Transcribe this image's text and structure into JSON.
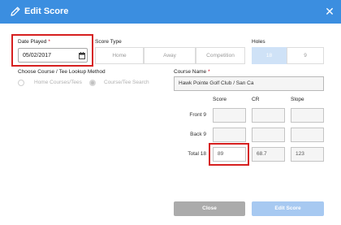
{
  "dialog": {
    "title": "Edit Score",
    "close_symbol": "✕"
  },
  "date_played": {
    "label": "Date Played",
    "required_mark": "*",
    "value": "05/02/2017"
  },
  "score_type": {
    "label": "Score Type",
    "options": [
      "Home",
      "Away",
      "Competition"
    ]
  },
  "holes": {
    "label": "Holes",
    "options": [
      "18",
      "9"
    ],
    "selected": "18"
  },
  "lookup": {
    "label": "Choose Course / Tee Lookup Method",
    "options": [
      "Home Courses/Tees",
      "Course/Tee Search"
    ],
    "selected": "Course/Tee Search"
  },
  "course_name": {
    "label": "Course Name",
    "required_mark": "*",
    "value": "Hawk Pointe Golf Club / San Ca"
  },
  "score_table": {
    "columns": [
      "Score",
      "CR",
      "Slope"
    ],
    "rows": [
      {
        "label": "Front 9",
        "score": "",
        "cr": "",
        "slope": ""
      },
      {
        "label": "Back 9",
        "score": "",
        "cr": "",
        "slope": ""
      },
      {
        "label": "Total 18",
        "score": "89",
        "cr": "68.7",
        "slope": "123"
      }
    ]
  },
  "buttons": {
    "close": "Close",
    "edit": "Edit Score"
  },
  "colors": {
    "header": "#3b8ee0",
    "highlight": "#d61f1f",
    "selected_segment": "#cfe2f7",
    "primary_disabled": "#a7c9f1",
    "secondary_button": "#ababab"
  },
  "icons": {
    "header": "pencil-icon",
    "close": "close-icon",
    "date": "calendar-icon"
  }
}
